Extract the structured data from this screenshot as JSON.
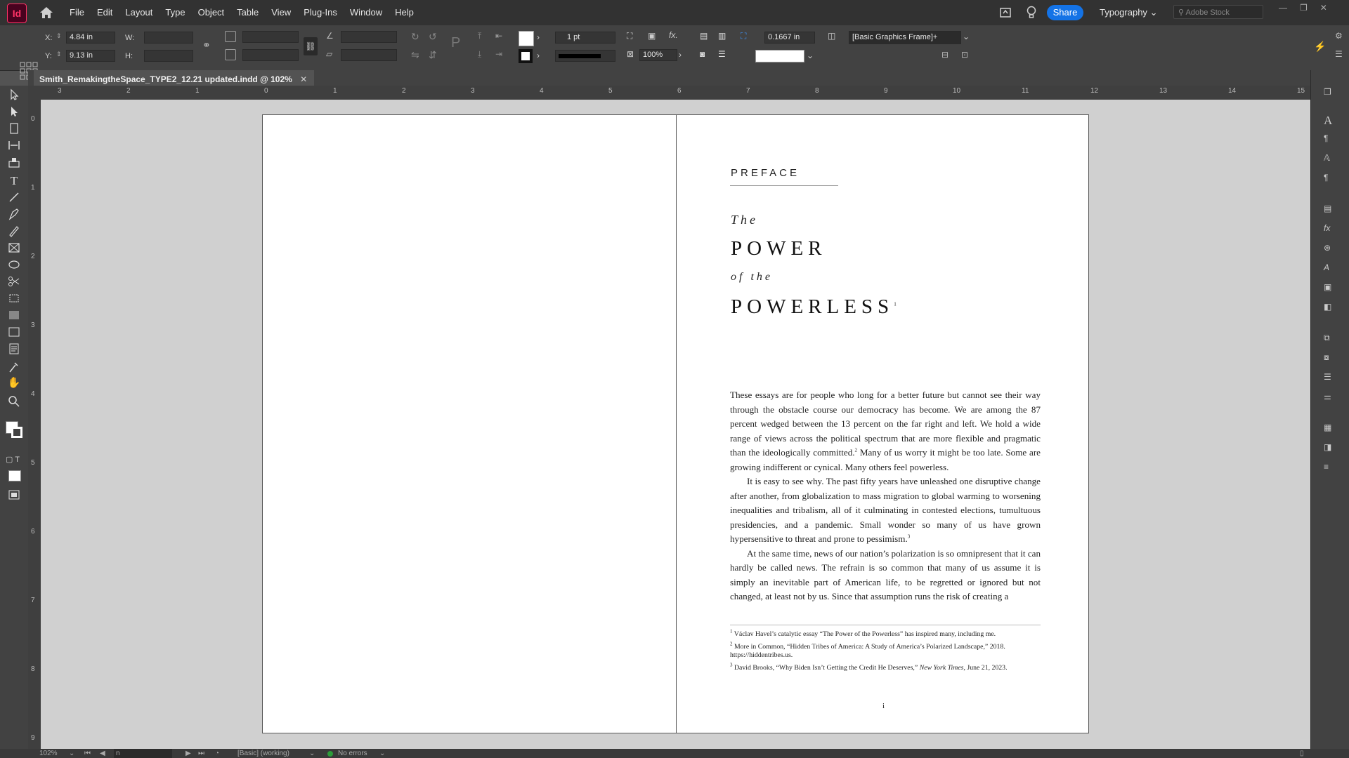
{
  "app": {
    "logo": "Id"
  },
  "menu": [
    "File",
    "Edit",
    "Layout",
    "Type",
    "Object",
    "Table",
    "View",
    "Plug-Ins",
    "Window",
    "Help"
  ],
  "header": {
    "share": "Share",
    "workspace": "Typography",
    "stock_placeholder": "Adobe Stock"
  },
  "control": {
    "x_label": "X:",
    "x_value": "4.84 in",
    "y_label": "Y:",
    "y_value": "9.13 in",
    "w_label": "W:",
    "h_label": "H:",
    "stroke_weight": "1 pt",
    "opacity": "100%",
    "offset": "0.1667 in",
    "object_style": "[Basic Graphics Frame]+"
  },
  "document": {
    "tab_title": "Smith_RemakingtheSpace_TYPE2_12.21 updated.indd @ 102%"
  },
  "ruler": {
    "h_ticks": [
      "3",
      "2",
      "1",
      "0",
      "1",
      "2",
      "3",
      "4",
      "5",
      "6",
      "7",
      "8",
      "9",
      "10",
      "11",
      "12",
      "13",
      "14",
      "15"
    ],
    "v_ticks": [
      "0",
      "1",
      "2",
      "3",
      "4",
      "5",
      "6",
      "7",
      "8",
      "9"
    ]
  },
  "page": {
    "section": "PREFACE",
    "title_line1": "The",
    "title_line2": "POWER",
    "title_line3": "of the",
    "title_line4": "POWERLESS",
    "title_note": "1",
    "p1_a": "These essays are for people who long for a better future but cannot see their way through the obstacle course our democracy has become. We are among the 87 percent wedged between the 13 percent on the far right and left. We hold a wide range of views across the political spectrum that are more flexible and pragmatic than the ideologically committed.",
    "p1_note": "2",
    "p1_b": " Many of us worry it might be too late. Some are growing indifferent or cynical. Many others feel powerless.",
    "p2_a": "It is easy to see why. The past fifty years have unleashed one disruptive change after another, from globalization to mass migration to global warming to worsening inequalities and tribalism, all of it culminating in contested elections, tumultuous presidencies, and a pandemic. Small wonder so many of us have grown hypersensitive to threat and prone to pessimism.",
    "p2_note": "3",
    "p3": "At the same time, news of our nation’s polarization is so omnipresent that it can hardly be called news. The refrain is so common that many of us assume it is simply an inevitable part of American life, to be regretted or ignored but not changed, at least not by us. Since that assumption runs the risk of creating a",
    "footnotes": [
      {
        "num": "1",
        "text": " Václav Havel’s catalytic essay “The Power of the Powerless” has inspired many, including me."
      },
      {
        "num": "2",
        "text": " More in Common, “Hidden Tribes of America: A Study of America’s Polarized Landscape,” 2018. https://hiddentribes.us."
      },
      {
        "num": "3",
        "text": " David Brooks, “Why Biden Isn’t Getting the Credit He Deserves,” ",
        "em": "New York Times,",
        "tail": " June 21, 2023."
      }
    ],
    "folio": "i"
  },
  "status": {
    "zoom": "102%",
    "page": "n",
    "preflight_profile": "[Basic] (working)",
    "errors": "No errors"
  },
  "colors": {
    "accent": "#1473e6",
    "app_brand": "#ff3366",
    "ok_status": "#2d9d3a"
  }
}
